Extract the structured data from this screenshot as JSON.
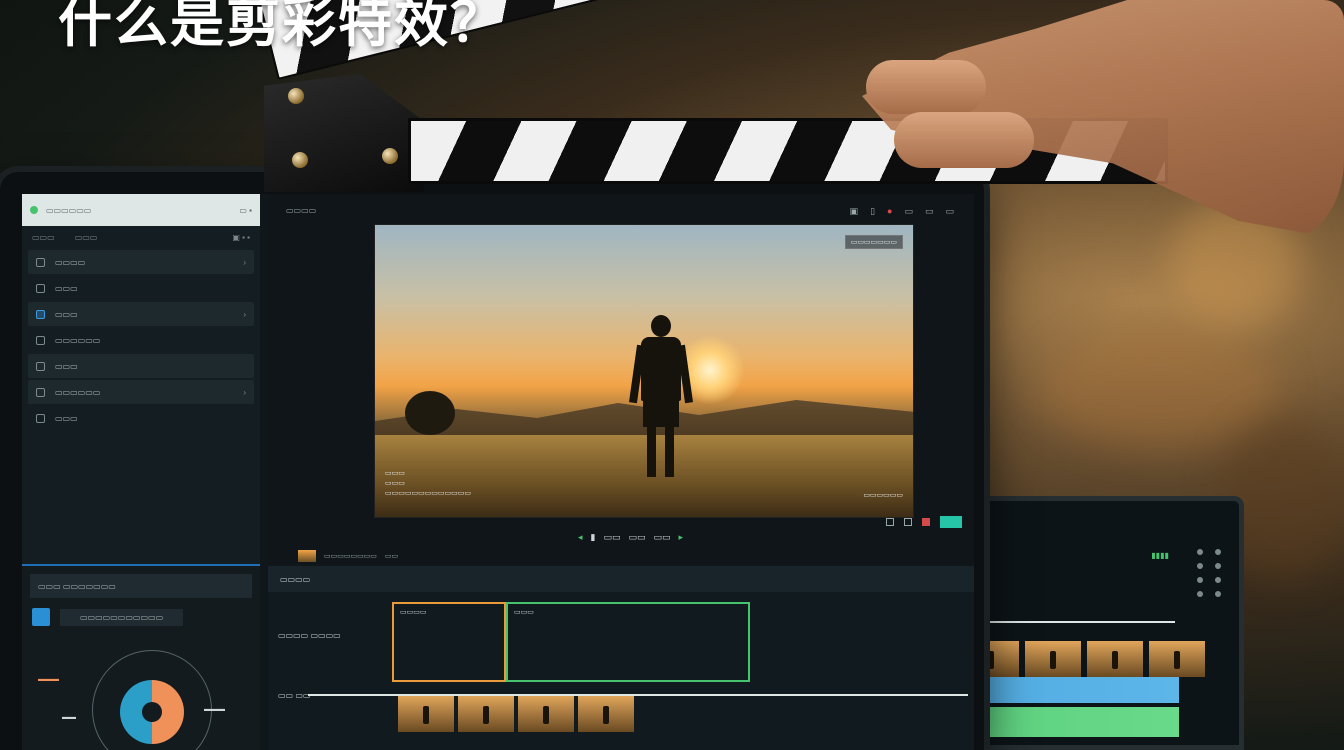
{
  "headline": "什么是剪彩特效？",
  "colors": {
    "accent_blue": "#2b9fe0",
    "accent_green": "#46c46d",
    "accent_orange": "#e99a3a",
    "record_red": "#e04a4a",
    "clapper_white": "#f0f0f0",
    "clapper_black": "#0d0d0d"
  },
  "icons": [
    "clapperboard",
    "screw",
    "chevron-right-icon",
    "record-icon",
    "play-icon",
    "color-wheel"
  ]
}
